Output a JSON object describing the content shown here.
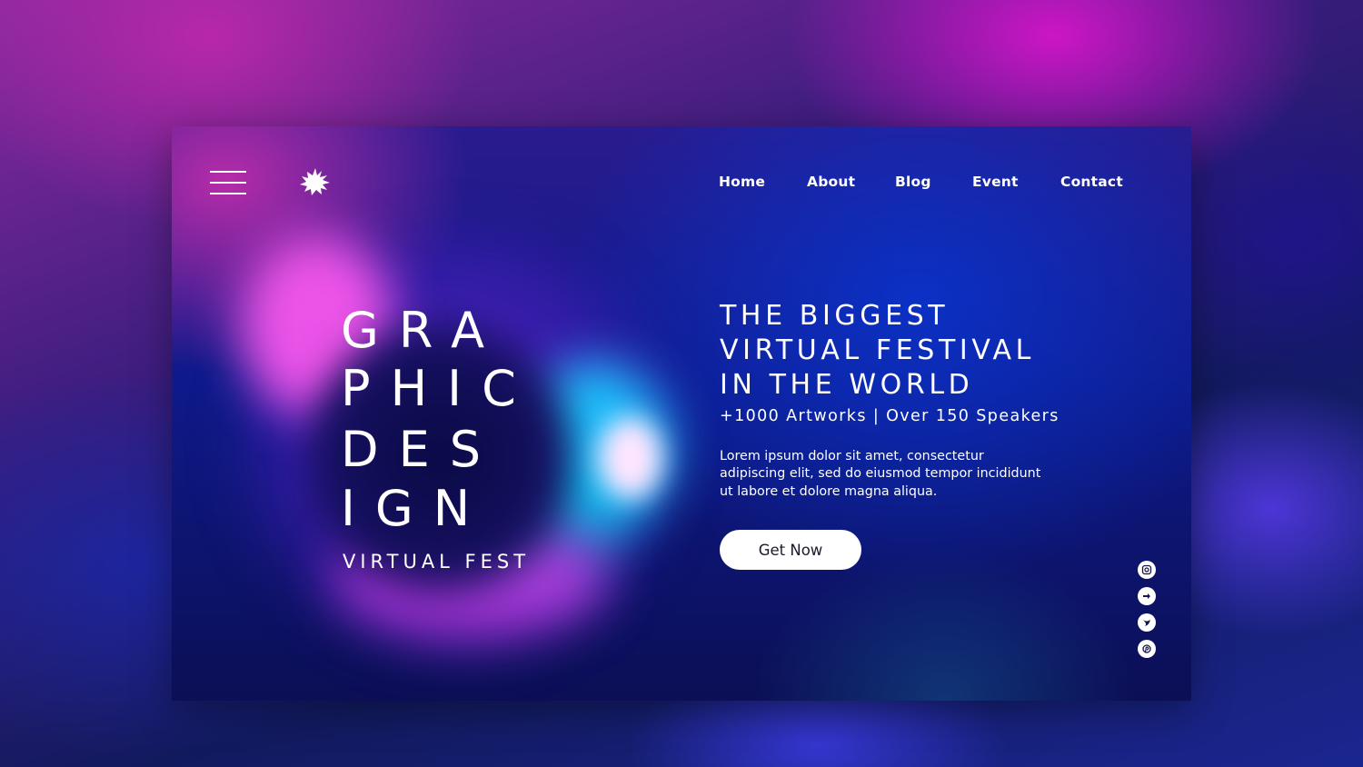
{
  "nav": {
    "items": [
      {
        "label": "Home"
      },
      {
        "label": "About"
      },
      {
        "label": "Blog"
      },
      {
        "label": "Event"
      },
      {
        "label": "Contact"
      }
    ]
  },
  "hero": {
    "title_lines": [
      "GRA",
      "PHIC",
      "DES",
      "IGN"
    ],
    "subtitle": "VIRTUAL FEST",
    "headline_lines": [
      "THE BIGGEST",
      "VIRTUAL FESTIVAL",
      "IN THE WORLD"
    ],
    "stats": "+1000 Artworks | Over 150 Speakers",
    "description": "Lorem ipsum dolor sit amet, consectetur adipiscing elit, sed do eiusmod tempor incididunt ut labore et dolore magna aliqua.",
    "cta_label": "Get Now"
  },
  "icons": {
    "menu": "menu-icon",
    "logo": "splash-logo-icon",
    "social": [
      "instagram-icon",
      "facebook-icon",
      "twitter-icon",
      "pinterest-icon"
    ]
  },
  "colors": {
    "background": "#1a0f6a",
    "accent_pink": "#ff5af0",
    "accent_cyan": "#1ec8ff",
    "deep_blue": "#0e1a8a",
    "button_bg": "#ffffff",
    "text": "#ffffff"
  }
}
